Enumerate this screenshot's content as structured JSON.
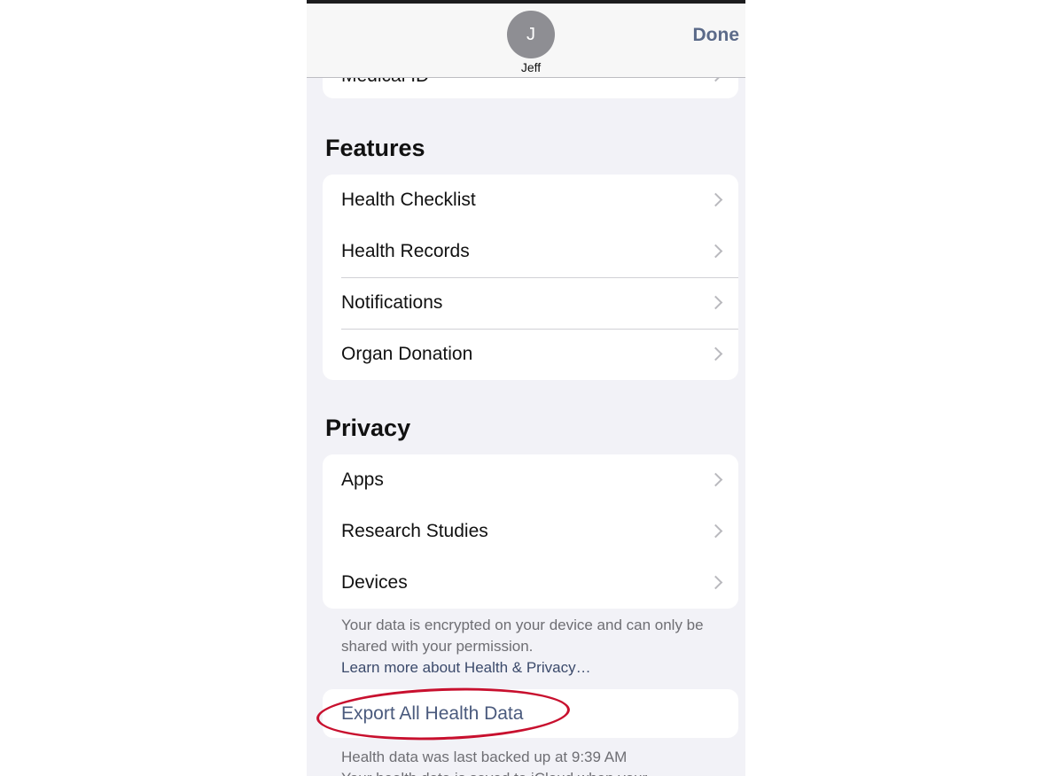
{
  "header": {
    "avatar_initial": "J",
    "user_name": "Jeff",
    "done_label": "Done"
  },
  "medical_id_label": "Medical ID",
  "features": {
    "title": "Features",
    "items": [
      {
        "label": "Health Checklist",
        "icon": "chevron-right-icon"
      },
      {
        "label": "Health Records",
        "icon": "chevron-right-icon"
      },
      {
        "label": "Notifications",
        "icon": "chevron-right-icon"
      },
      {
        "label": "Organ Donation",
        "icon": "chevron-right-icon"
      }
    ]
  },
  "privacy": {
    "title": "Privacy",
    "items": [
      {
        "label": "Apps",
        "icon": "chevron-right-icon"
      },
      {
        "label": "Research Studies",
        "icon": "chevron-right-icon"
      },
      {
        "label": "Devices",
        "icon": "chevron-right-icon"
      }
    ],
    "footnote": "Your data is encrypted on your device and can only be shared with your permission.",
    "footnote_link": "Learn more about Health & Privacy…"
  },
  "export": {
    "label": "Export All Health Data",
    "backup_note": "Health data was last backed up at 9:39 AM",
    "icloud_note": "Your health data is saved to iCloud when your"
  },
  "colors": {
    "background": "#f2f2f7",
    "accent": "#5b6a89",
    "highlight_oval": "#c8102e"
  }
}
